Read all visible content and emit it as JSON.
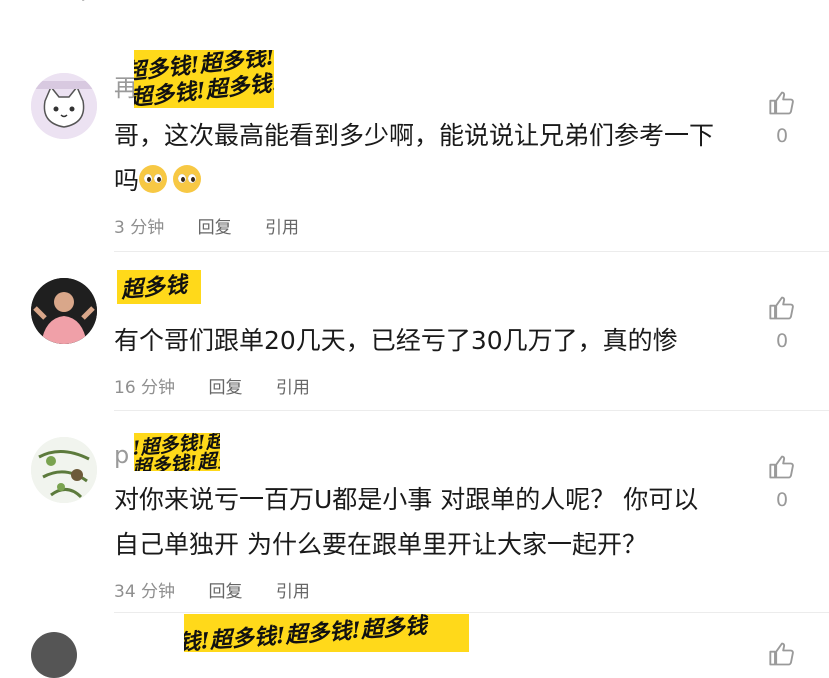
{
  "comments": [
    {
      "username_visible": "再",
      "sticker_text": "超多钱!超多钱!超多钱!超",
      "text_line1": "哥，这次最高能看到多少啊，能说说让兄弟们参考一下",
      "text_line2": "吗",
      "time": "3 分钟",
      "reply": "回复",
      "quote": "引用",
      "likes": "0"
    },
    {
      "username_visible": "",
      "sticker_text": "超多钱",
      "text_line1": "有个哥们跟单20几天，已经亏了30几万了，真的惨",
      "text_line2": "",
      "time": "16 分钟",
      "reply": "回复",
      "quote": "引用",
      "likes": "0"
    },
    {
      "username_visible": "p",
      "sticker_text": "!超多钱!超多钱",
      "text_line1": "对你来说亏一百万U都是小事 对跟单的人呢？ 你可以",
      "text_line2": "自己单独开 为什么要在跟单里开让大家一起开？",
      "time": "34 分钟",
      "reply": "回复",
      "quote": "引用",
      "likes": "0"
    },
    {
      "username_visible": "",
      "sticker_text": "钱!超多钱!超多钱!超多钱",
      "text_line1": "",
      "text_line2": "",
      "time": "",
      "reply": "",
      "quote": "",
      "likes": ""
    }
  ],
  "icons": {
    "like": "thumbs-up-icon",
    "emoji": "pleading-face-emoji"
  },
  "colors": {
    "sticker": "#ffd91a",
    "meta": "#8f8f8f",
    "text": "#1a1a1a"
  }
}
